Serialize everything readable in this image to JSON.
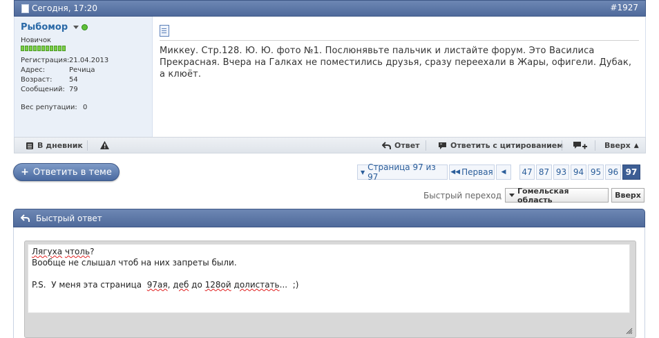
{
  "post": {
    "date": "Сегодня, 17:20",
    "number": "#1927",
    "user": {
      "name": "Рыбомор",
      "rank": "Новичок",
      "reputation_pips": 11,
      "registration_label": "Регистрация:",
      "registration_value": "21.04.2013",
      "address_label": "Адрес:",
      "address_value": "Речица",
      "age_label": "Возраст:",
      "age_value": "54",
      "messages_label": "Сообщений:",
      "messages_value": "79",
      "rep_weight_label": "Вес репутации:",
      "rep_weight_value": "0"
    },
    "message": "Миккеу. Стр.128. Ю. Ю. фото №1. Послюнявьте пальчик и листайте форум. Это Василиса Прекрасная. Вчера на Галках не поместились друзья, сразу переехали в Жары, офигели. Дубак, а клюёт."
  },
  "footer": {
    "diary_label": "В дневник",
    "reply_label": "Ответ",
    "quote_label": "Ответить с цитированием",
    "top_label": "Вверх"
  },
  "reply_button": {
    "label": "Ответить в теме"
  },
  "pagination": {
    "summary": "Страница 97 из 97",
    "first_label": "Первая",
    "pages": [
      "47",
      "87",
      "93",
      "94",
      "95",
      "96",
      "97"
    ],
    "current": "97"
  },
  "quick_nav": {
    "label": "Быстрый переход",
    "forum_label": "Гомельская область",
    "top_label": "Вверх"
  },
  "quick_reply": {
    "title": "Быстрый ответ",
    "lines": [
      "Лягуха чтоль?",
      "Вообще не слышал чтоб на них запреты были.",
      "",
      "P.S.  У меня эта страница  97ая, деб до 128ой долистать...  ;)"
    ]
  },
  "colors": {
    "header_blue": "#5673a5",
    "link_blue": "#2a69a7",
    "online_green": "#5fbf3a"
  }
}
